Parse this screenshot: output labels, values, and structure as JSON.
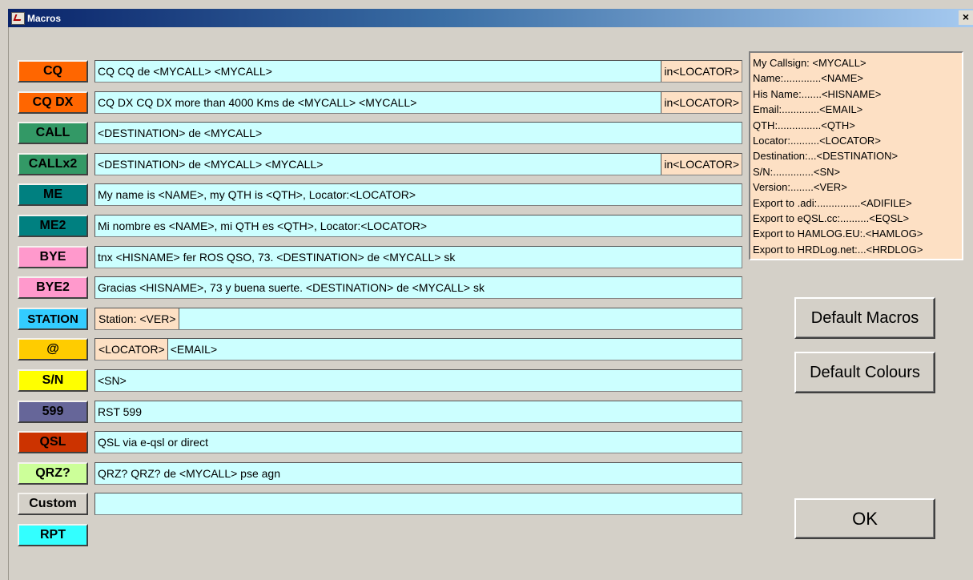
{
  "window": {
    "title": "Macros",
    "close_label": "×"
  },
  "macros": [
    {
      "label": "CQ",
      "color": "#ff6600",
      "text": "CQ  CQ  de  <MYCALL>  <MYCALL>",
      "suffix": "in<LOCATOR>"
    },
    {
      "label": "CQ DX",
      "color": "#ff6600",
      "text": "CQ DX CQ DX more than 4000 Kms de  <MYCALL>  <MYCALL>",
      "suffix": "in<LOCATOR>"
    },
    {
      "label": "CALL",
      "color": "#339966",
      "text": "<DESTINATION> de <MYCALL>"
    },
    {
      "label": "CALLx2",
      "color": "#339966",
      "text": "<DESTINATION>  de  <MYCALL>  <MYCALL>",
      "suffix": "in<LOCATOR>"
    },
    {
      "label": "ME",
      "color": "#008080",
      "text": "My name is <NAME>, my QTH is <QTH>, Locator:<LOCATOR>"
    },
    {
      "label": "ME2",
      "color": "#008080",
      "text": "Mi nombre es <NAME>, mi QTH es <QTH>, Locator:<LOCATOR>"
    },
    {
      "label": "BYE",
      "color": "#ff99cc",
      "text": "tnx <HISNAME> fer ROS QSO, 73. <DESTINATION> de <MYCALL> sk"
    },
    {
      "label": "BYE2",
      "color": "#ff99cc",
      "text": "Gracias <HISNAME>, 73 y buena suerte. <DESTINATION> de <MYCALL> sk"
    },
    {
      "label": "STATION",
      "color": "#33ccff",
      "prefix": "Station: <VER>",
      "text": ""
    },
    {
      "label": "@",
      "color": "#ffcc00",
      "prefix": "<LOCATOR>",
      "text": "<EMAIL>"
    },
    {
      "label": "S/N",
      "color": "#ffff00",
      "text": "<SN>"
    },
    {
      "label": "599",
      "color": "#666699",
      "text": "RST 599"
    },
    {
      "label": "QSL",
      "color": "#cc3300",
      "text": "QSL via e-qsl or direct"
    },
    {
      "label": "QRZ?",
      "color": "#ccff99",
      "text": "QRZ? QRZ? de <MYCALL> pse agn"
    },
    {
      "label": "Custom",
      "color": "#d4d0c8",
      "text": ""
    },
    {
      "label": "RPT",
      "color": "#33ffff"
    }
  ],
  "info": [
    "My Callsign: <MYCALL>",
    "Name:.............<NAME>",
    "His Name:.......<HISNAME>",
    "Email:.............<EMAIL>",
    "QTH:...............<QTH>",
    "Locator:..........<LOCATOR>",
    "Destination:...<DESTINATION>",
    "S/N:..............<SN>",
    "Version:........<VER>",
    "Export to .adi:...............<ADIFILE>",
    "Export to eQSL.cc:..........<EQSL>",
    "Export to HAMLOG.EU:.<HAMLOG>",
    "Export to HRDLog.net:...<HRDLOG>"
  ],
  "buttons": {
    "default_macros": "Default Macros",
    "default_colours": "Default Colours",
    "ok": "OK"
  }
}
